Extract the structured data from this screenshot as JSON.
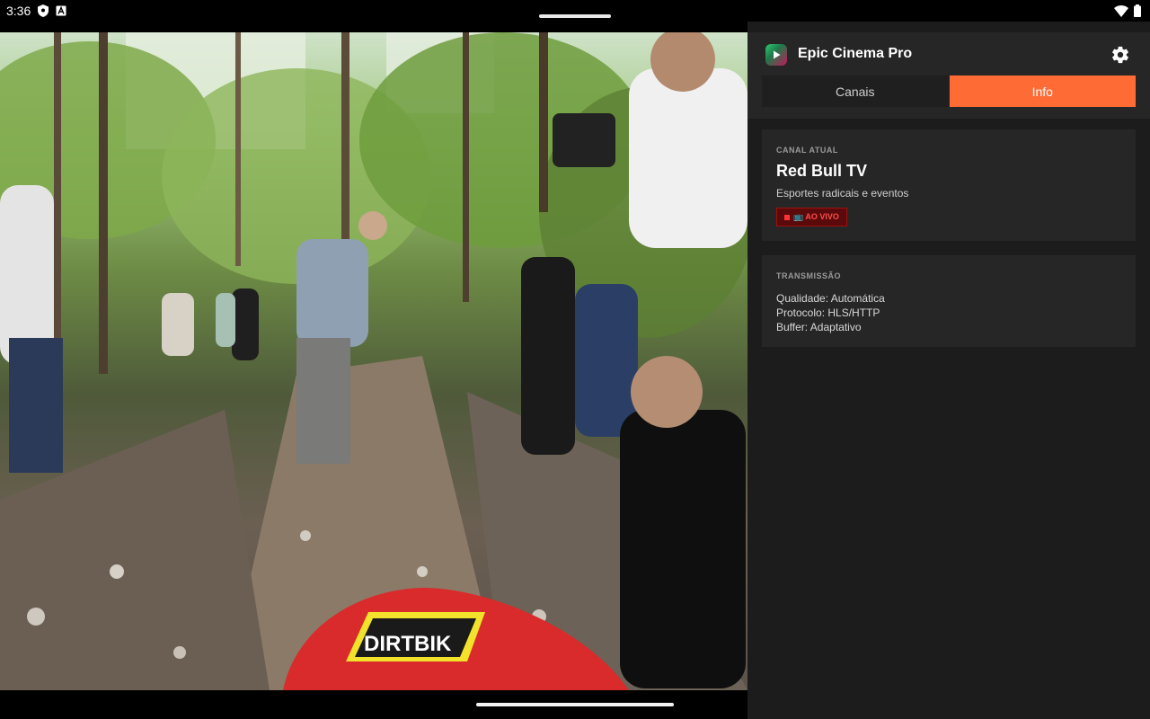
{
  "status_bar": {
    "time": "3:36"
  },
  "app": {
    "title": "Epic Cinema Pro",
    "accent_color": "#ff6b35"
  },
  "tabs": [
    {
      "label": "Canais",
      "active": false
    },
    {
      "label": "Info",
      "active": true
    }
  ],
  "current_channel": {
    "section_label": "CANAL ATUAL",
    "name": "Red Bull TV",
    "description": "Esportes radicais e eventos",
    "live_badge": "📺 AO VIVO"
  },
  "transmission": {
    "section_label": "TRANSMISSÃO",
    "quality": "Qualidade: Automática",
    "protocol": "Protocolo: HLS/HTTP",
    "buffer": "Buffer: Adaptativo"
  },
  "video": {
    "overlay_text": "DIRTBIK"
  }
}
